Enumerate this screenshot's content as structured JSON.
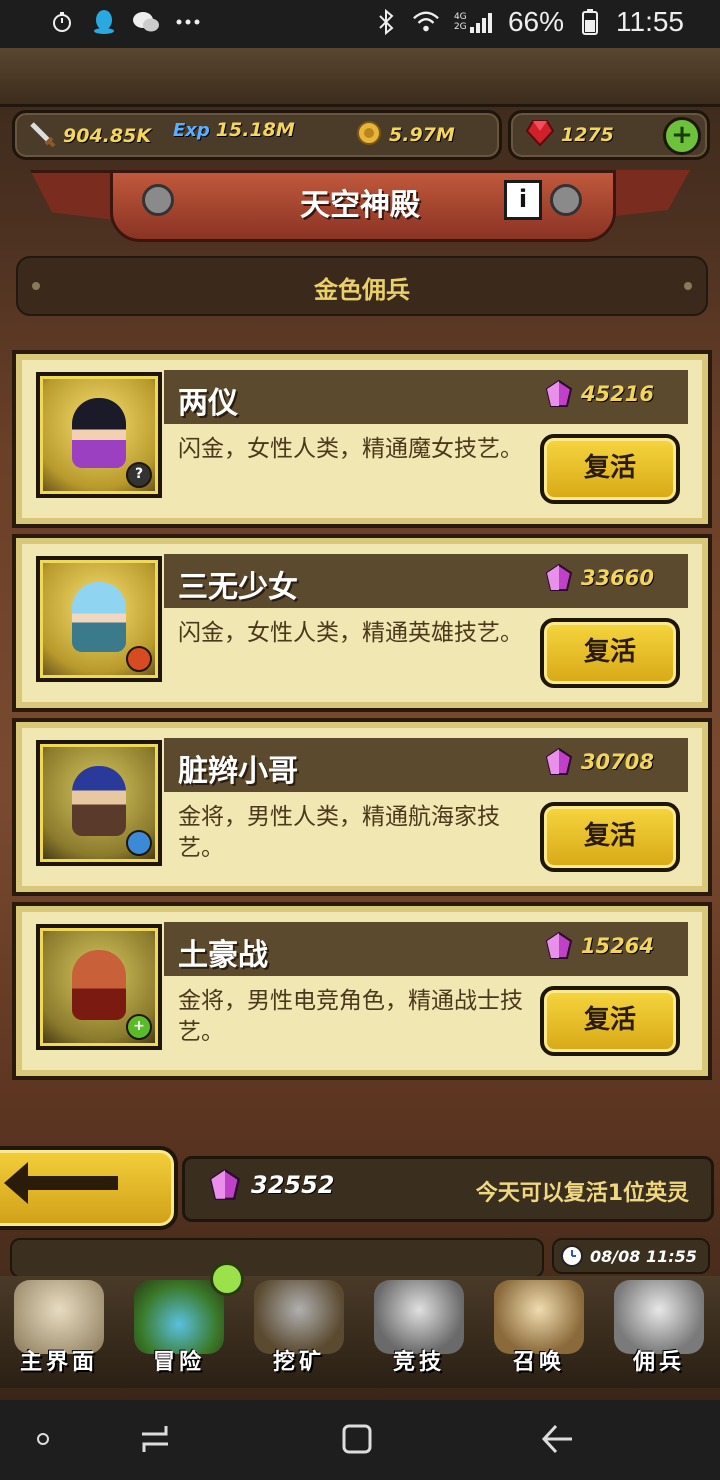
{
  "status_bar": {
    "network": "4G 2G",
    "battery": "66%",
    "time": "11:55"
  },
  "resources": {
    "attack": "904.85K",
    "exp_label": "Exp",
    "exp": "15.18M",
    "gold": "5.97M",
    "gems": "1275"
  },
  "header": {
    "title": "天空神殿",
    "info": "i"
  },
  "section": {
    "title": "金色佣兵"
  },
  "heroes": [
    {
      "name": "两仪",
      "cost": "45216",
      "desc": "闪金，女性人类，精通魔女技艺。",
      "badge": "?",
      "revive": "复活"
    },
    {
      "name": "三无少女",
      "cost": "33660",
      "desc": "闪金，女性人类，精通英雄技艺。",
      "badge": "",
      "revive": "复活"
    },
    {
      "name": "脏辫小哥",
      "cost": "30708",
      "desc": "金将，男性人类，精通航海家技艺。",
      "badge": "",
      "revive": "复活"
    },
    {
      "name": "土豪战",
      "cost": "15264",
      "desc": "金将，男性电竞角色，精通战士技艺。",
      "badge": "+",
      "revive": "复活"
    }
  ],
  "footer": {
    "gem_total": "32552",
    "revive_note": "今天可以复活1位英灵",
    "date_time": "08/08 11:55"
  },
  "nav": [
    {
      "label": "主界面"
    },
    {
      "label": "冒险"
    },
    {
      "label": "挖矿"
    },
    {
      "label": "竞技"
    },
    {
      "label": "召唤"
    },
    {
      "label": "佣兵"
    }
  ]
}
